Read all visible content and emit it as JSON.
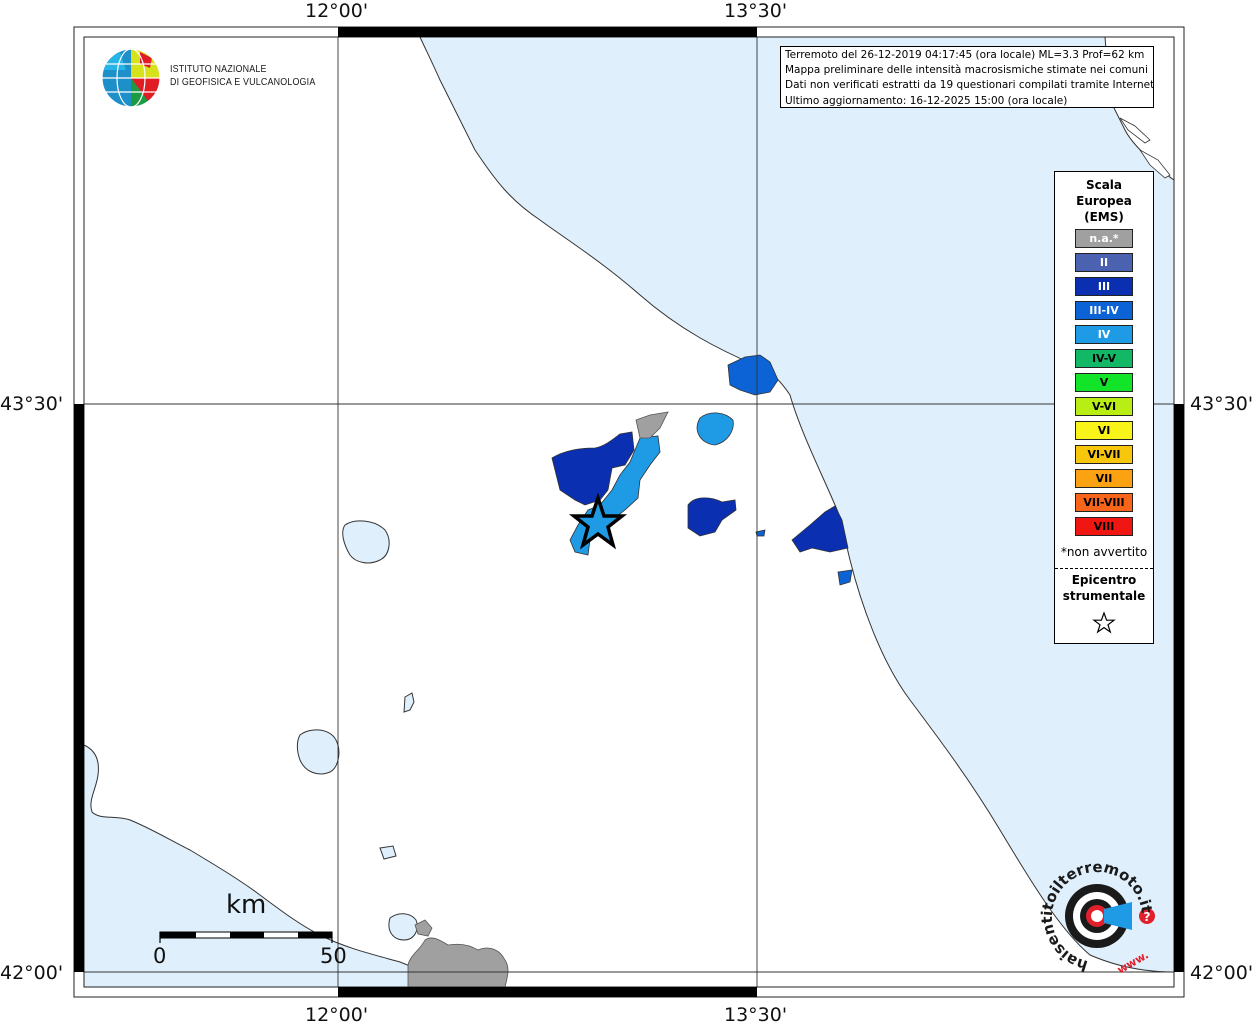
{
  "map": {
    "lon_labels": [
      "12°00'",
      "13°30'"
    ],
    "lat_labels": [
      "43°30'",
      "42°00'"
    ],
    "sea_color": "#dff0fc",
    "land_color": "#ffffff"
  },
  "logo": {
    "line1": "ISTITUTO NAZIONALE",
    "line2": "DI GEOFISICA E VULCANOLOGIA"
  },
  "info": {
    "line1": "Terremoto del 26-12-2019 04:17:45 (ora locale) ML=3.3 Prof=62 km",
    "line2": "Mappa preliminare delle intensità macrosismiche stimate nei comuni",
    "line3": "Dati non verificati estratti da 19 questionari compilati tramite Internet.",
    "line4": "Ultimo aggiornamento: 16-12-2025 15:00 (ora locale)"
  },
  "legend": {
    "title_line1": "Scala",
    "title_line2": "Europea",
    "title_line3": "(EMS)",
    "items": [
      {
        "label": "n.a.*",
        "color": "#a0a0a0",
        "text_color": "#ffffff"
      },
      {
        "label": "II",
        "color": "#4a62b0",
        "text_color": "#ffffff"
      },
      {
        "label": "III",
        "color": "#0a2fb0",
        "text_color": "#ffffff"
      },
      {
        "label": "III-IV",
        "color": "#0c63d6",
        "text_color": "#ffffff"
      },
      {
        "label": "IV",
        "color": "#1f9be6",
        "text_color": "#ffffff"
      },
      {
        "label": "IV-V",
        "color": "#12b866",
        "text_color": "#000000"
      },
      {
        "label": "V",
        "color": "#12e42a",
        "text_color": "#000000"
      },
      {
        "label": "V-VI",
        "color": "#b8ee14",
        "text_color": "#000000"
      },
      {
        "label": "VI",
        "color": "#f8f41a",
        "text_color": "#000000"
      },
      {
        "label": "VI-VII",
        "color": "#f9c60e",
        "text_color": "#000000"
      },
      {
        "label": "VII",
        "color": "#fba212",
        "text_color": "#000000"
      },
      {
        "label": "VII-VIII",
        "color": "#f8641a",
        "text_color": "#000000"
      },
      {
        "label": "VIII",
        "color": "#f01612",
        "text_color": "#000000"
      }
    ],
    "note": "*non avvertito",
    "epi_line1": "Epicentro",
    "epi_line2": "strumentale",
    "epi_icon": "star-outline-icon"
  },
  "scale_bar": {
    "unit": "km",
    "start": "0",
    "end": "50"
  },
  "badge": {
    "text": "haisentitoilterremoto.it",
    "www": "www.",
    "icon": "question-mark-icon"
  }
}
